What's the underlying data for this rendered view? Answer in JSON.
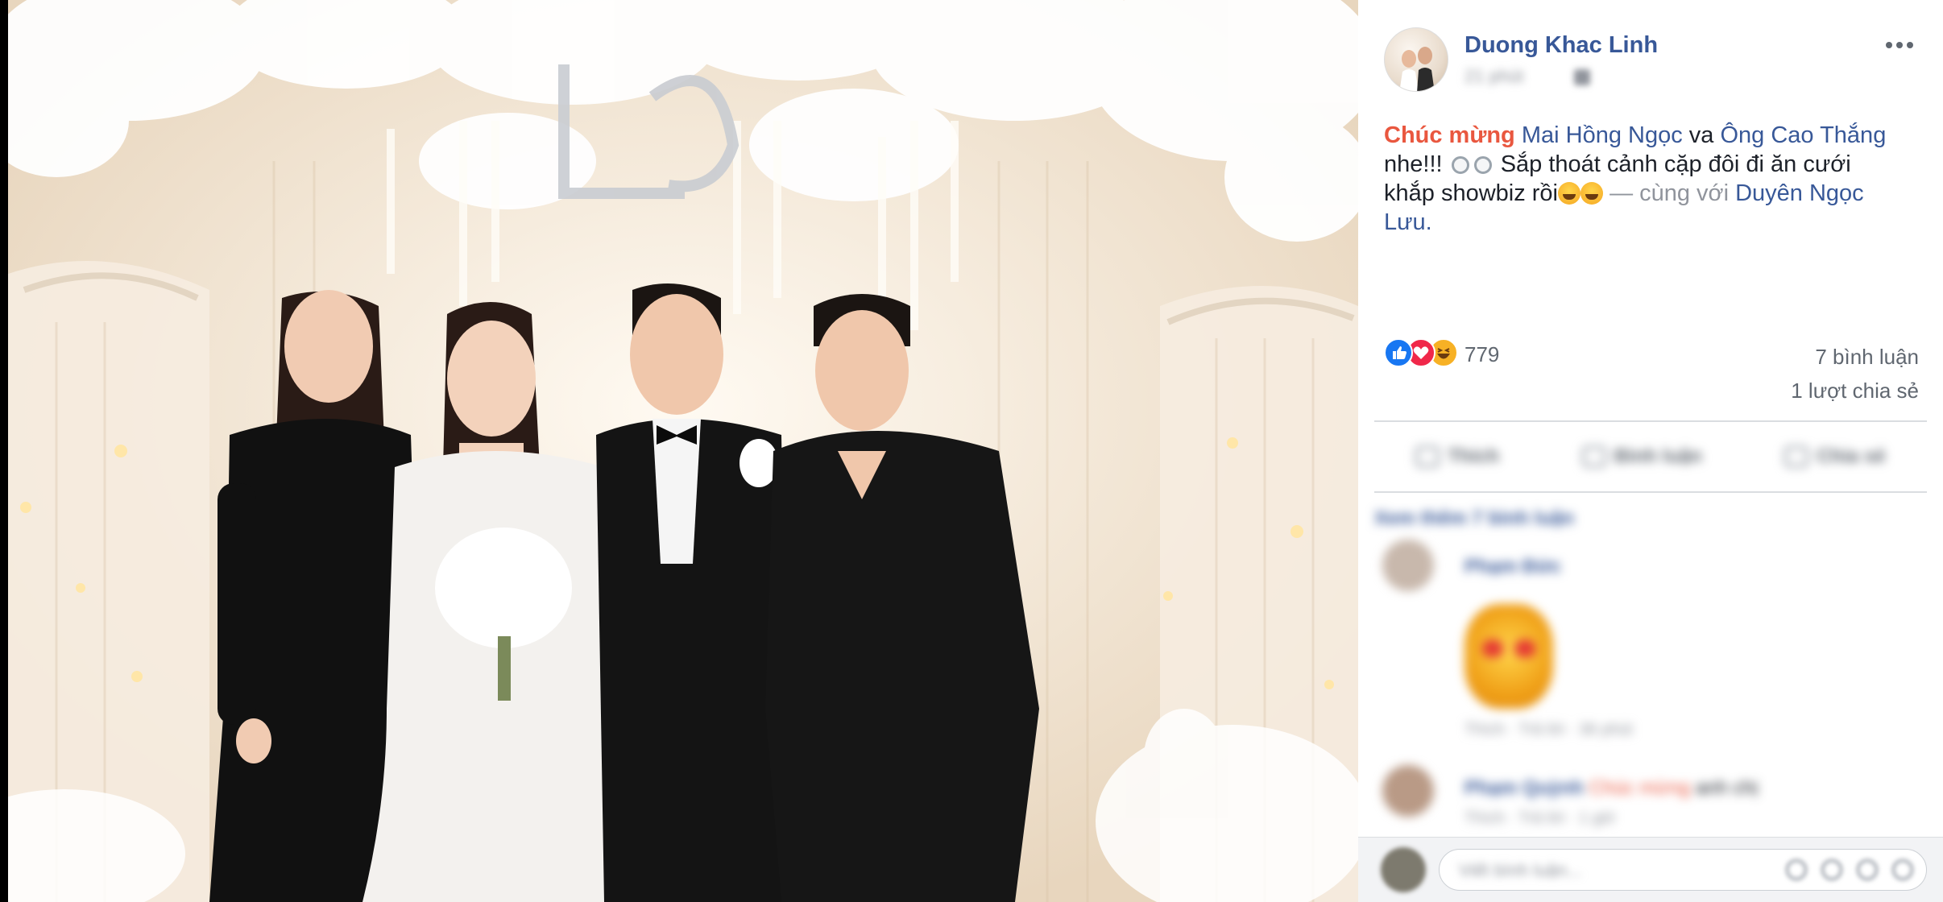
{
  "post": {
    "author_name": "Duong Khac Linh",
    "timestamp": "21 phút",
    "text": {
      "congrats": "Chúc mừng",
      "tag1": "Mai Hồng Ngọc",
      "conj": "va",
      "tag2": "Ông Cao Thắng",
      "line2_start": "nhe!!!",
      "line2_end": "Sắp thoát cảnh cặp đôi đi ăn cưới",
      "line3_start": "khắp showbiz rồi",
      "with_phrase": "— cùng với",
      "tag3": "Duyên Ngọc Lưu."
    },
    "reactions": {
      "count": "779",
      "types": [
        "like",
        "love",
        "haha"
      ]
    },
    "comments_count": "7 bình luận",
    "shares_count": "1 lượt chia sẻ"
  },
  "actions": {
    "like_label": "Thích",
    "comment_label": "Bình luận",
    "share_label": "Chia sẻ"
  },
  "comments": {
    "view_more_label": "Xem thêm 7 bình luận",
    "items": [
      {
        "name": "Phạm Đức",
        "meta": "Thích · Trả lời · 36 phút"
      },
      {
        "name": "Phạm Quỳnh",
        "highlight": "Chúc mừng",
        "text": "anh chị",
        "meta": "Thích · Trả lời · 1 giờ"
      }
    ]
  },
  "composer": {
    "placeholder": "Viết bình luận..."
  },
  "colors": {
    "link": "#385898",
    "highlight": "#e9573f",
    "muted": "#90949c"
  }
}
